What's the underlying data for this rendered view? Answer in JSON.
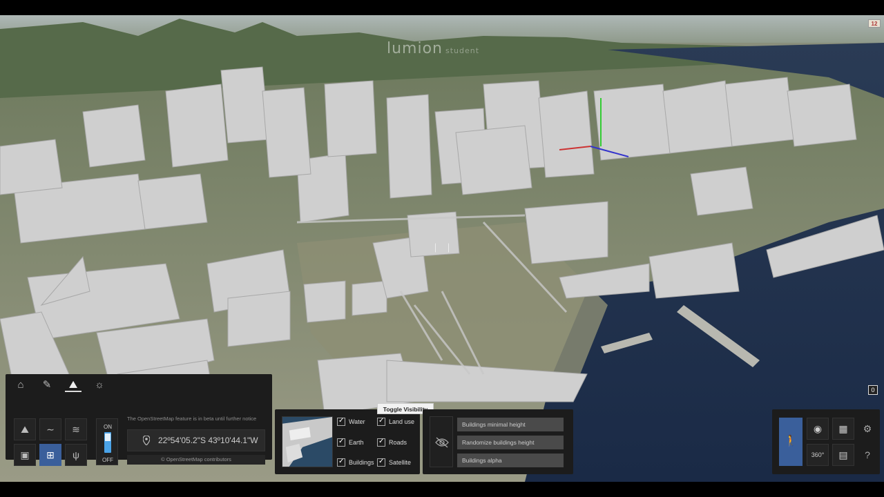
{
  "app": {
    "watermark": "lumion",
    "watermark_sub": "student",
    "fps_badge": "12",
    "camera_badge": "0"
  },
  "left_panel": {
    "tabs": [
      {
        "name": "home-tab",
        "icon": "house-icon"
      },
      {
        "name": "paint-tab",
        "icon": "brush-icon"
      },
      {
        "name": "landscape-tab",
        "icon": "mountain-icon",
        "active": true
      },
      {
        "name": "weather-tab",
        "icon": "sun-cloud-icon"
      }
    ],
    "tools": [
      {
        "name": "height-tool",
        "icon": "terrain-icon"
      },
      {
        "name": "water-tool",
        "icon": "wave-icon"
      },
      {
        "name": "ocean-tool",
        "icon": "waves-icon"
      },
      {
        "name": "paint-terrain-tool",
        "icon": "paint-roller-icon"
      },
      {
        "name": "openstreetmap-tool",
        "icon": "map-icon",
        "selected": true
      },
      {
        "name": "grass-tool",
        "icon": "grass-icon"
      }
    ],
    "toggle_on": "ON",
    "toggle_off": "OFF",
    "beta_notice": "The OpenStreetMap feature is in beta until further notice",
    "coordinates": "22º54'05.2\"S 43º10'44.1\"W",
    "osm_credit": "© OpenStreetMap contributors"
  },
  "layers_panel": {
    "checkboxes": [
      {
        "label": "Water",
        "checked": true
      },
      {
        "label": "Land use",
        "checked": true
      },
      {
        "label": "Earth",
        "checked": true
      },
      {
        "label": "Roads",
        "checked": true
      },
      {
        "label": "Buildings",
        "checked": true
      },
      {
        "label": "Satellite",
        "checked": true
      }
    ]
  },
  "tooltip": "Toggle Visibility",
  "settings_panel": {
    "buttons": [
      "Buildings minimal height",
      "Randomize buildings height",
      "Buildings alpha"
    ]
  },
  "right_panel": {
    "mode_icon": "walk-icon",
    "buttons": [
      "camera-icon",
      "film-icon",
      "orbit-360-icon",
      "save-icon"
    ],
    "side_icons": [
      "gear-icon",
      "help-icon"
    ]
  },
  "colors": {
    "accent": "#3a5f9b",
    "water": "#1d2d4c",
    "buildings": "#d8d8d8",
    "panel": "#1c1c1c"
  }
}
